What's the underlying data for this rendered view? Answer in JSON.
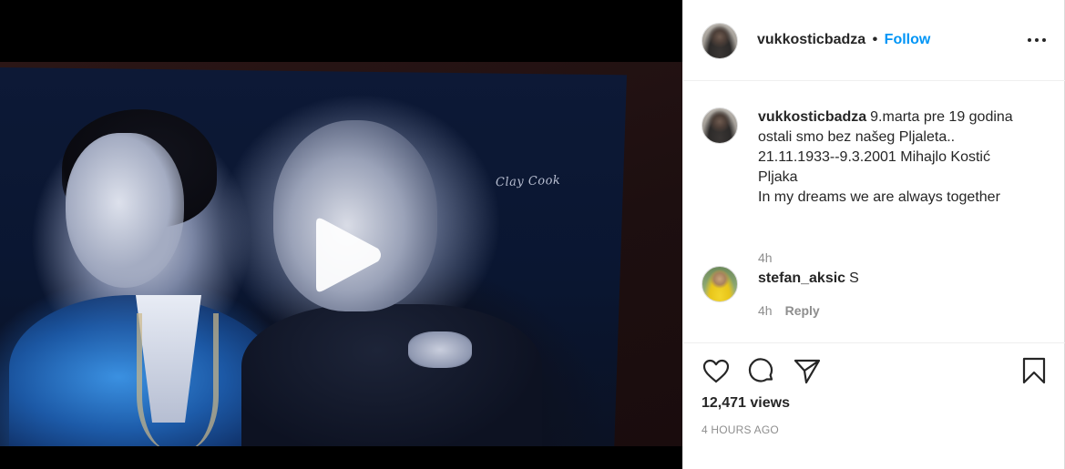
{
  "post": {
    "username": "vukkosticbadza",
    "separator": "•",
    "follow_label": "Follow",
    "more_icon": "more-options-icon",
    "media": {
      "signature_text": "Clay Cook",
      "play_icon": "play-icon"
    },
    "caption": {
      "username": "vukkosticbadza",
      "lines": [
        "9.marta pre 19 godina",
        "ostali smo bez našeg Pljaleta..",
        "21.11.1933--9.3.2001 Mihajlo Kostić",
        "Pljaka",
        "In my dreams we are always together"
      ],
      "time": "4h"
    },
    "comments": [
      {
        "username": "stefan_aksic",
        "text": "S",
        "time": "4h",
        "reply_label": "Reply"
      }
    ],
    "actions": {
      "like_icon": "heart-icon",
      "comment_icon": "comment-icon",
      "share_icon": "share-icon",
      "save_icon": "bookmark-icon"
    },
    "views": "12,471 views",
    "timestamp": "4 HOURS AGO"
  }
}
